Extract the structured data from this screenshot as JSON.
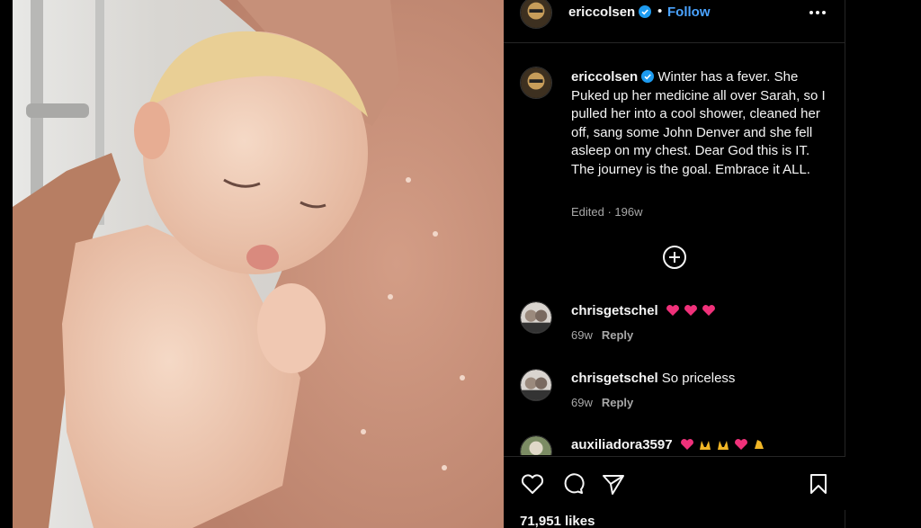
{
  "post": {
    "username": "ericcolsen",
    "separator": "•",
    "follow_label": "Follow",
    "caption_text": "Winter has a fever. She Puked up her medicine all over Sarah, so I pulled her into a cool shower, cleaned her off, sang some John Denver and she fell asleep on my chest. Dear God this is IT. The journey is the goal. Embrace it ALL.",
    "edited_label": "Edited · 196w",
    "likes": "71,951 likes"
  },
  "comments": [
    {
      "username": "chrisgetschel",
      "text": "",
      "emoji": [
        "heart",
        "heart",
        "heart"
      ],
      "age": "69w",
      "reply_label": "Reply"
    },
    {
      "username": "chrisgetschel",
      "text": "So priceless",
      "emoji": [],
      "age": "69w",
      "reply_label": "Reply"
    },
    {
      "username": "auxiliadora3597",
      "text": "",
      "emoji": [
        "heart",
        "raised-hands",
        "raised-hands",
        "heart",
        "clapping-hands"
      ],
      "age": "",
      "reply_label": ""
    }
  ],
  "icons": {
    "verified": "verified-badge-icon",
    "more": "more-options-icon",
    "add_comment": "plus-circle-icon",
    "like": "heart-outline-icon",
    "comment": "comment-bubble-icon",
    "share": "send-icon",
    "save": "bookmark-icon"
  },
  "colors": {
    "background": "#000000",
    "text": "#f5f5f5",
    "muted": "#a8a8a8",
    "link": "#4aa3ff",
    "verified": "#1d9bf0",
    "heart_emoji": "#f0317a"
  }
}
